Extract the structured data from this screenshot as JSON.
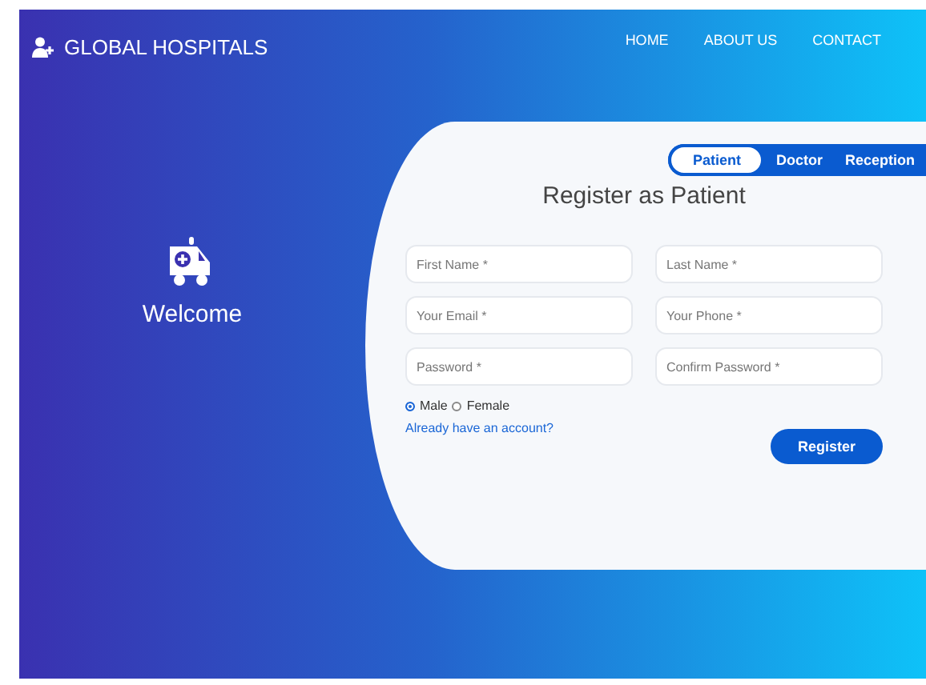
{
  "navbar": {
    "brand": "GLOBAL HOSPITALS",
    "links": [
      "HOME",
      "ABOUT US",
      "CONTACT"
    ]
  },
  "welcome": {
    "text": "Welcome"
  },
  "tabs": [
    {
      "label": "Patient",
      "selected": true
    },
    {
      "label": "Doctor",
      "selected": false
    },
    {
      "label": "Reception",
      "selected": false
    }
  ],
  "form": {
    "title": "Register as Patient",
    "fields": [
      {
        "placeholder": "First Name *"
      },
      {
        "placeholder": "Last Name *"
      },
      {
        "placeholder": "Your Email *"
      },
      {
        "placeholder": "Your Phone *"
      },
      {
        "placeholder": "Password *"
      },
      {
        "placeholder": "Confirm Password *"
      }
    ],
    "gender": [
      {
        "label": "Male",
        "selected": true
      },
      {
        "label": "Female",
        "selected": false
      }
    ],
    "login_link": "Already have an account?",
    "submit": "Register"
  }
}
